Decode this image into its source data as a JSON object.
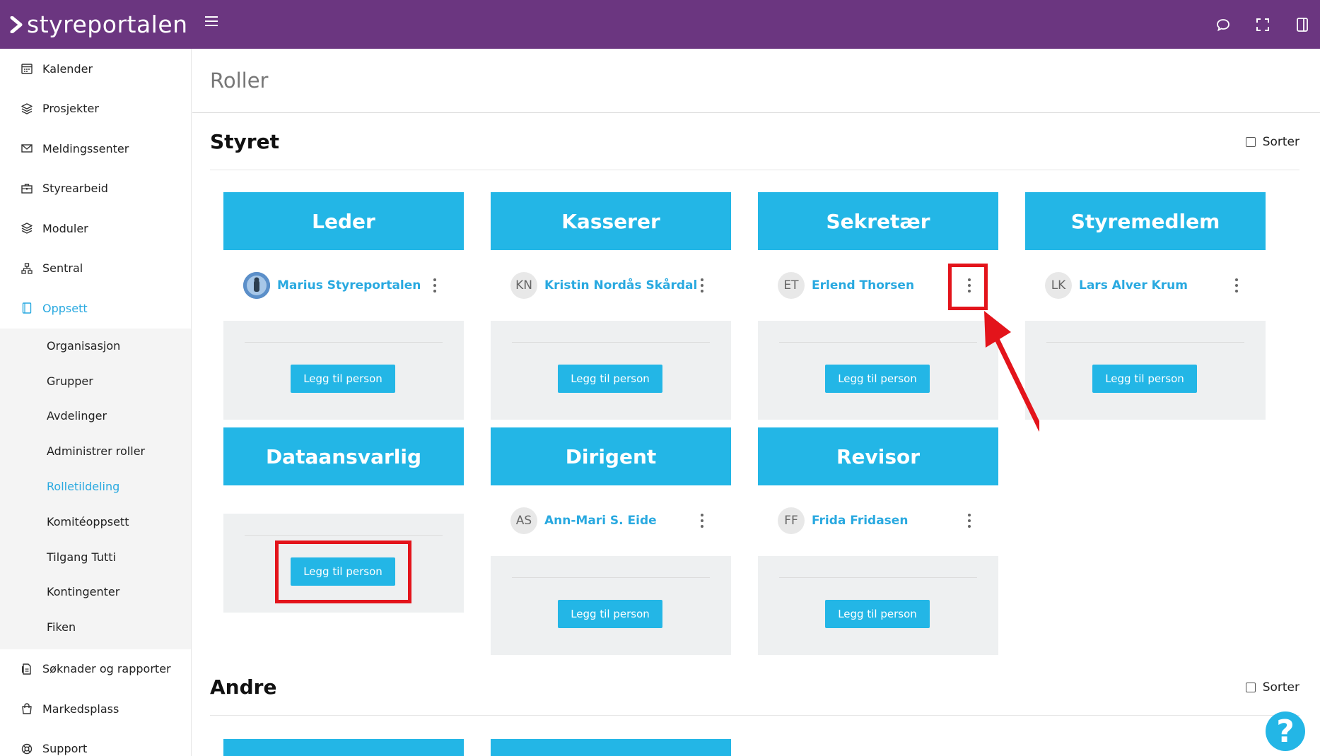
{
  "app": {
    "logo_text": "styreportalen"
  },
  "topbar": {
    "icons": [
      "chat-icon",
      "fullscreen-icon",
      "panel-icon"
    ]
  },
  "sidebar": {
    "items_top": [
      {
        "label": "Kalender",
        "icon": "calendar-icon"
      },
      {
        "label": "Prosjekter",
        "icon": "layers-icon"
      },
      {
        "label": "Meldingssenter",
        "icon": "mail-icon"
      },
      {
        "label": "Styrearbeid",
        "icon": "briefcase-icon"
      },
      {
        "label": "Moduler",
        "icon": "layers-icon"
      },
      {
        "label": "Sentral",
        "icon": "network-icon"
      },
      {
        "label": "Oppsett",
        "icon": "tablet-icon"
      }
    ],
    "sub_items": [
      "Organisasjon",
      "Grupper",
      "Avdelinger",
      "Administrer roller",
      "Rolletildeling",
      "Komitéoppsett",
      "Tilgang Tutti",
      "Kontingenter",
      "Fiken"
    ],
    "items_bottom": [
      {
        "label": "Søknader og rapporter",
        "icon": "document-icon"
      },
      {
        "label": "Markedsplass",
        "icon": "bag-icon"
      },
      {
        "label": "Support",
        "icon": "lifebuoy-icon"
      }
    ]
  },
  "page": {
    "title": "Roller"
  },
  "sections": {
    "styret": {
      "title": "Styret",
      "sort_label": "Sorter"
    },
    "andre": {
      "title": "Andre",
      "sort_label": "Sorter"
    }
  },
  "add_label": "Legg til person",
  "cards": [
    {
      "role": "Leder",
      "person": {
        "initials": "",
        "name": "Marius Styreportalen",
        "photo": true
      }
    },
    {
      "role": "Kasserer",
      "person": {
        "initials": "KN",
        "name": "Kristin Nordås Skårdal"
      }
    },
    {
      "role": "Sekretær",
      "person": {
        "initials": "ET",
        "name": "Erlend Thorsen"
      }
    },
    {
      "role": "Styremedlem",
      "person": {
        "initials": "LK",
        "name": "Lars Alver Krum"
      }
    },
    {
      "role": "Dataansvarlig",
      "person": null
    },
    {
      "role": "Dirigent",
      "person": {
        "initials": "AS",
        "name": "Ann-Mari S. Eide"
      }
    },
    {
      "role": "Revisor",
      "person": {
        "initials": "FF",
        "name": "Frida Fridasen"
      }
    }
  ],
  "help": {
    "label": "?"
  }
}
